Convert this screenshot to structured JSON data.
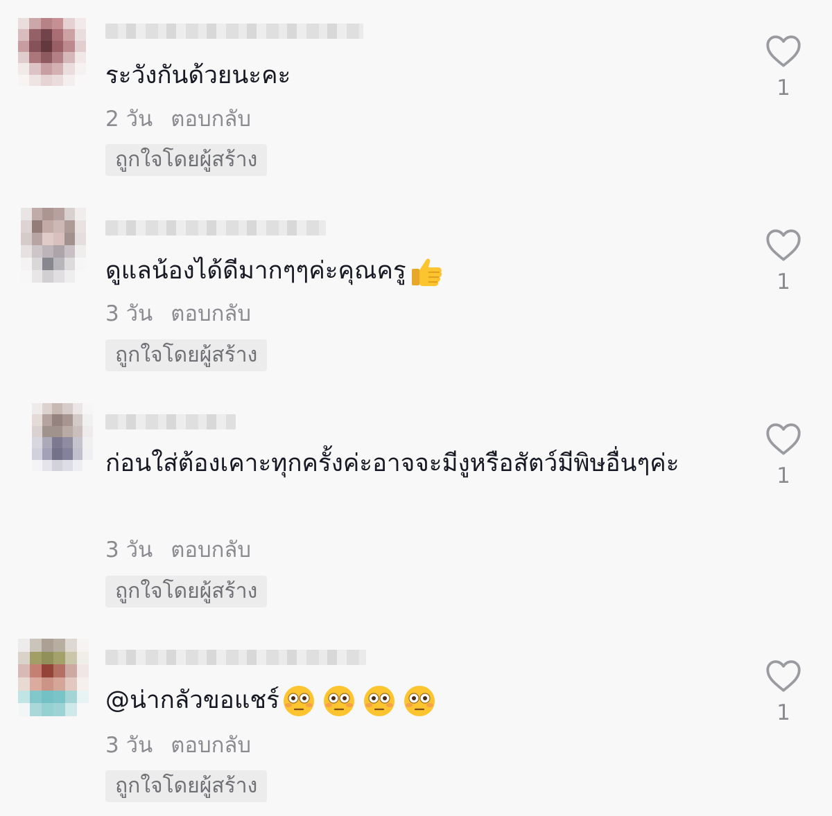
{
  "comments": [
    {
      "text": "ระวังกันด้วยนะคะ",
      "time": "2 วัน",
      "reply_label": "ตอบกลับ",
      "creator_badge": "ถูกใจโดยผู้สร้าง",
      "likes": "1",
      "emoji": []
    },
    {
      "text": "ดูแลน้องได้ดีมากๆๆค่ะคุณครู",
      "time": "3 วัน",
      "reply_label": "ตอบกลับ",
      "creator_badge": "ถูกใจโดยผู้สร้าง",
      "likes": "1",
      "emoji": [
        "thumbs-up"
      ]
    },
    {
      "text": "ก่อนใส่ต้องเคาะทุกครั้งค่ะอาจจะมีงูหรือสัตว์มีพิษอื่นๆค่ะ",
      "time": "3 วัน",
      "reply_label": "ตอบกลับ",
      "creator_badge": "ถูกใจโดยผู้สร้าง",
      "likes": "1",
      "emoji": []
    },
    {
      "text": "@น่ากลัวขอแชร์",
      "time": "3 วัน",
      "reply_label": "ตอบกลับ",
      "creator_badge": "ถูกใจโดยผู้สร้าง",
      "likes": "1",
      "emoji": [
        "flushed-face",
        "flushed-face",
        "flushed-face",
        "flushed-face"
      ]
    }
  ],
  "colors": {
    "background": "#f9f8f8",
    "text": "#161823",
    "secondary_text": "#8a8b91",
    "badge_background": "#ececec",
    "heart_stroke": "#9a9ba0"
  }
}
